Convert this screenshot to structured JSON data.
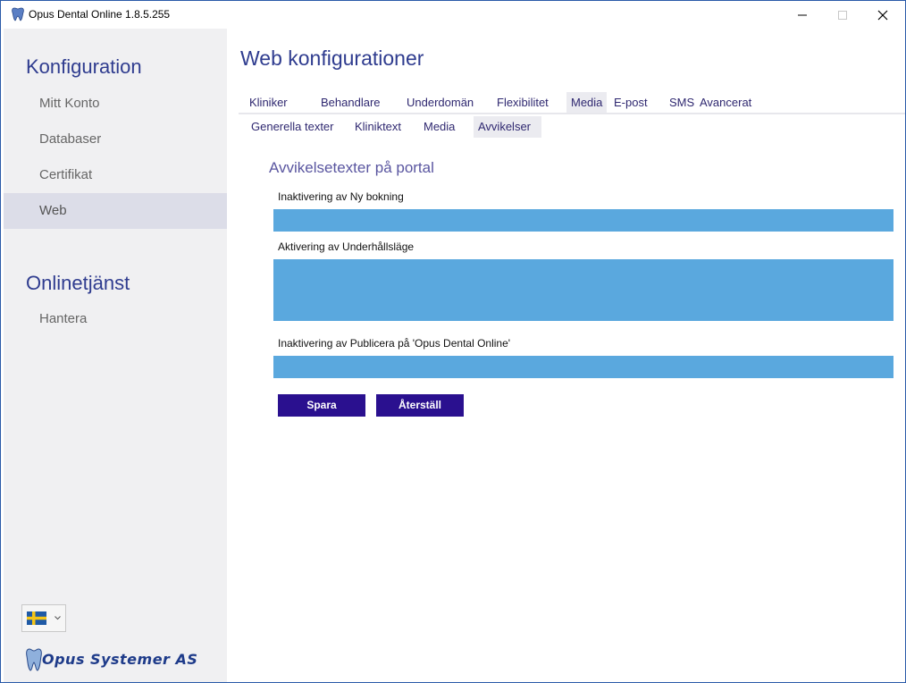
{
  "window": {
    "title": "Opus Dental Online 1.8.5.255"
  },
  "sidebar": {
    "config_title": "Konfiguration",
    "config_items": [
      {
        "label": "Mitt Konto"
      },
      {
        "label": "Databaser"
      },
      {
        "label": "Certifikat"
      },
      {
        "label": "Web",
        "active": true
      }
    ],
    "online_title": "Onlinetjänst",
    "online_items": [
      {
        "label": "Hantera"
      }
    ],
    "language": "Swedish flag",
    "logo_text": "Opus Systemer AS"
  },
  "main": {
    "page_title": "Web konfigurationer",
    "tabs": [
      {
        "label": "Kliniker"
      },
      {
        "label": "Behandlare"
      },
      {
        "label": "Underdomän"
      },
      {
        "label": "Flexibilitet"
      },
      {
        "label": "Media",
        "active": true
      },
      {
        "label": "E-post"
      },
      {
        "label": "SMS"
      },
      {
        "label": "Avancerat"
      }
    ],
    "subtabs": [
      {
        "label": "Generella texter"
      },
      {
        "label": "Kliniktext"
      },
      {
        "label": "Media"
      },
      {
        "label": "Avvikelser",
        "active": true
      }
    ],
    "section_heading": "Avvikelsetexter på portal",
    "fields": [
      {
        "label": "Inaktivering av Ny bokning",
        "value": ""
      },
      {
        "label": "Aktivering av Underhållsläge",
        "value": ""
      },
      {
        "label": "Inaktivering av Publicera på 'Opus Dental Online'",
        "value": ""
      }
    ],
    "save_label": "Spara",
    "reset_label": "Återställ"
  },
  "colors": {
    "accent": "#2f3c8f",
    "field_bg": "#5aa8de",
    "button_bg": "#2a108f",
    "sidebar_bg": "#f0f0f2",
    "active_bg": "#dcdde8"
  }
}
